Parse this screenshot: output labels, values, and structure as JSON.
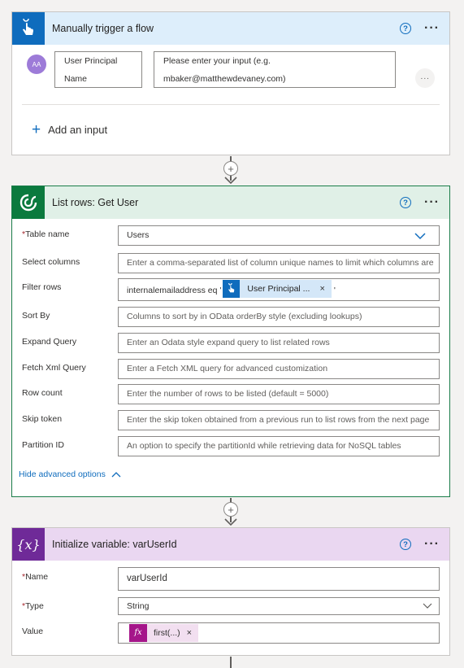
{
  "trigger": {
    "title": "Manually trigger a flow",
    "help": "?",
    "more": "···",
    "avatar_text": "AA",
    "input_name_line1": "User Principal",
    "input_name_line2": "Name",
    "input_desc_line1": "Please enter your input (e.g.",
    "input_desc_line2": "mbaker@matthewdevaney.com)",
    "input_more": "···",
    "add_input_label": "Add an input"
  },
  "connector": {
    "plus": "+"
  },
  "list_rows": {
    "title": "List rows: Get User",
    "help": "?",
    "more": "···",
    "fields": {
      "table_name": {
        "label": "Table name",
        "value": "Users"
      },
      "select_columns": {
        "label": "Select columns",
        "placeholder": "Enter a comma-separated list of column unique names to limit which columns are"
      },
      "filter_rows": {
        "label": "Filter rows",
        "prefix": "internalemailaddress eq '",
        "token": "User Principal ...",
        "token_remove": "×",
        "suffix": "'"
      },
      "sort_by": {
        "label": "Sort By",
        "placeholder": "Columns to sort by in OData orderBy style (excluding lookups)"
      },
      "expand_query": {
        "label": "Expand Query",
        "placeholder": "Enter an Odata style expand query to list related rows"
      },
      "fetch_xml": {
        "label": "Fetch Xml Query",
        "placeholder": "Enter a Fetch XML query for advanced customization"
      },
      "row_count": {
        "label": "Row count",
        "placeholder": "Enter the number of rows to be listed (default = 5000)"
      },
      "skip_token": {
        "label": "Skip token",
        "placeholder": "Enter the skip token obtained from a previous run to list rows from the next page"
      },
      "partition_id": {
        "label": "Partition ID",
        "placeholder": "An option to specify the partitionId while retrieving data for NoSQL tables"
      }
    },
    "hide_advanced": "Hide advanced options"
  },
  "init_var": {
    "title": "Initialize variable: varUserId",
    "icon_text": "{x}",
    "help": "?",
    "more": "···",
    "fields": {
      "name": {
        "label": "Name",
        "value": "varUserId"
      },
      "type": {
        "label": "Type",
        "value": "String"
      },
      "value": {
        "label": "Value",
        "token_icon": "fx",
        "token": "first(...)",
        "token_remove": "×"
      }
    }
  },
  "required_mark": "*",
  "colors": {
    "trigger_header": "#ddeefb",
    "trigger_icon": "#0f6cbd",
    "dataverse_header": "#e0f0e7",
    "dataverse_icon": "#0b7a3e",
    "variable_header": "#ead7f1",
    "variable_icon": "#6f2a98",
    "link": "#0f6cbd",
    "required": "#a4262c"
  }
}
